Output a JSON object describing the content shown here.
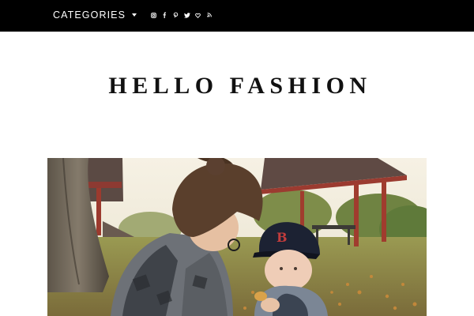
{
  "nav": {
    "categories_label": "CATEGORIES",
    "social_icons": [
      "instagram-icon",
      "facebook-icon",
      "pinterest-icon",
      "twitter-icon",
      "bloglovin-icon",
      "rss-icon"
    ]
  },
  "site": {
    "title": "HELLO FASHION"
  },
  "colors": {
    "topbar_bg": "#000000",
    "page_bg": "#ffffff",
    "title_text": "#111111"
  },
  "featured_post": {
    "image": "photo-mother-and-baby-in-park"
  }
}
